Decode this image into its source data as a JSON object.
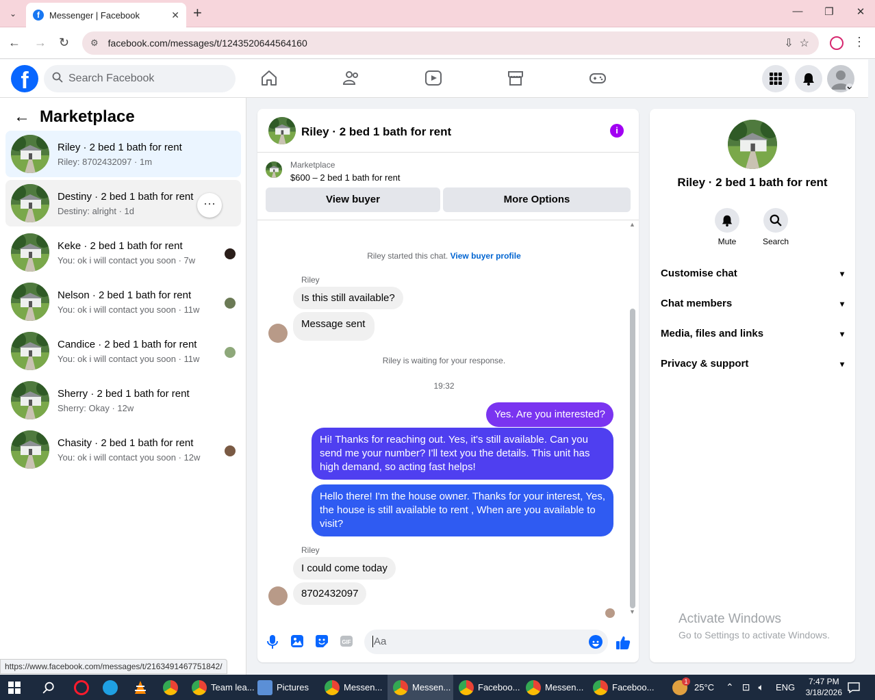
{
  "browser": {
    "tab_title": "Messenger | Facebook",
    "url": "facebook.com/messages/t/1243520644564160",
    "status_url": "https://www.facebook.com/messages/t/2163491467751842/"
  },
  "fb_header": {
    "search_placeholder": "Search Facebook"
  },
  "left_panel": {
    "title": "Marketplace",
    "conversations": [
      {
        "title": "Riley · 2 bed 1 bath for rent",
        "subtitle": "Riley: 8702432097 · 1m"
      },
      {
        "title": "Destiny · 2 bed 1 bath for rent",
        "subtitle": "Destiny: alright · 1d"
      },
      {
        "title": "Keke · 2 bed 1 bath for rent",
        "subtitle": "You: ok i will contact you soon · 7w"
      },
      {
        "title": "Nelson · 2 bed 1 bath for rent",
        "subtitle": "You: ok i will contact you soon · 11w"
      },
      {
        "title": "Candice · 2 bed 1 bath for rent",
        "subtitle": "You: ok i will contact you soon · 11w"
      },
      {
        "title": "Sherry · 2 bed 1 bath for rent",
        "subtitle": "Sherry: Okay · 12w"
      },
      {
        "title": "Chasity · 2 bed 1 bath for rent",
        "subtitle": "You: ok i will contact you soon · 12w"
      }
    ]
  },
  "chat": {
    "title": "Riley · 2 bed 1 bath for rent",
    "marketplace_label": "Marketplace",
    "listing": "$600 – 2 bed 1 bath for rent",
    "view_buyer": "View buyer",
    "more_options": "More Options",
    "started_text": "Riley started this chat.",
    "view_buyer_profile": "View buyer profile",
    "sender_name": "Riley",
    "msg_in_1": "Is this still available?",
    "msg_in_2": "Message sent",
    "waiting": "Riley is waiting for your response.",
    "time": "19:32",
    "msg_out_1": "Yes. Are you interested?",
    "msg_out_2": "Hi!  Thanks for reaching out.  Yes, it's still available.  Can you send me your number? I'll  text you the details.  This unit has high demand, so acting fast helps!",
    "msg_out_3": "Hello there! I'm the house owner. Thanks for your interest, Yes, the house is still available to rent , When are you available to visit?",
    "msg_in_3": "I could come today",
    "msg_in_4": "8702432097",
    "composer_placeholder": "Aa"
  },
  "info_panel": {
    "name": "Riley · 2 bed 1 bath for rent",
    "mute": "Mute",
    "search": "Search",
    "rows": [
      "Customise chat",
      "Chat members",
      "Media, files and links",
      "Privacy & support"
    ],
    "activate_title": "Activate Windows",
    "activate_sub": "Go to Settings to activate Windows."
  },
  "taskbar": {
    "items": [
      "Team lea...",
      "Pictures",
      "Messen...",
      "Messen...",
      "Faceboo...",
      "Messen...",
      "Faceboo..."
    ],
    "temp": "25°C",
    "lang": "ENG",
    "time": "7:47 PM",
    "date": "3/18/2026",
    "weather_badge": "1"
  },
  "colors": {
    "fb_blue": "#0866ff",
    "bubble_purple": "#7a34f0",
    "bubble_indigo": "#4f3ff0",
    "bubble_blue": "#2f5bf2",
    "info_purple": "#a100f2"
  }
}
